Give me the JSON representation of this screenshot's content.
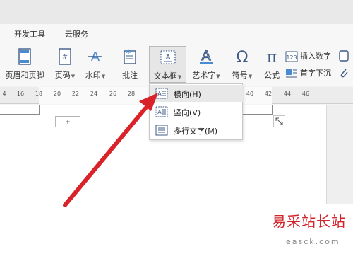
{
  "menu_tabs": [
    "开发工具",
    "云服务"
  ],
  "ribbon": {
    "header_footer": "页眉和页脚",
    "page_number": "页码",
    "watermark": "水印",
    "comment": "批注",
    "textbox": "文本框",
    "wordart": "艺术字",
    "symbol": "符号",
    "formula": "公式",
    "insert_number": "插入数字",
    "drop_cap": "首字下沉"
  },
  "ruler_ticks": [
    "4",
    "16",
    "18",
    "20",
    "22",
    "24",
    "26",
    "28",
    "40",
    "42",
    "44",
    "46"
  ],
  "textbox_menu": {
    "items": [
      {
        "label": "横向(H)",
        "icon": "horizontal-textbox-icon",
        "highlighted": true
      },
      {
        "label": "竖向(V)",
        "icon": "vertical-textbox-icon",
        "highlighted": false
      },
      {
        "label": "多行文字(M)",
        "icon": "multiline-text-icon",
        "highlighted": false
      }
    ]
  },
  "page": {
    "add_button": "+"
  },
  "watermark_text": {
    "main": "易采站长站",
    "sub": "easck.com"
  },
  "colors": {
    "arrow": "#d9232a",
    "ribbon_bg": "#f7f7f7",
    "watermark": "#d3242c"
  }
}
